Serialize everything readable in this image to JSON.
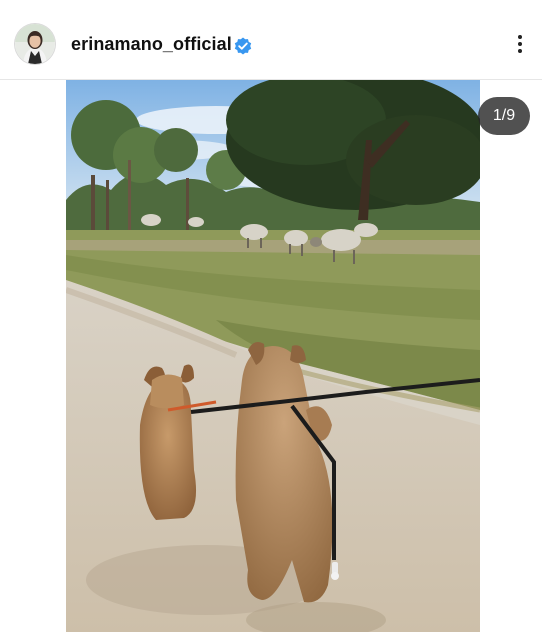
{
  "post": {
    "username": "erinamano_official",
    "verified": true,
    "verified_icon": "verified-badge-icon",
    "more_icon": "more-vertical-icon",
    "image_counter": "1/9",
    "accent_color": "#3897f0"
  }
}
